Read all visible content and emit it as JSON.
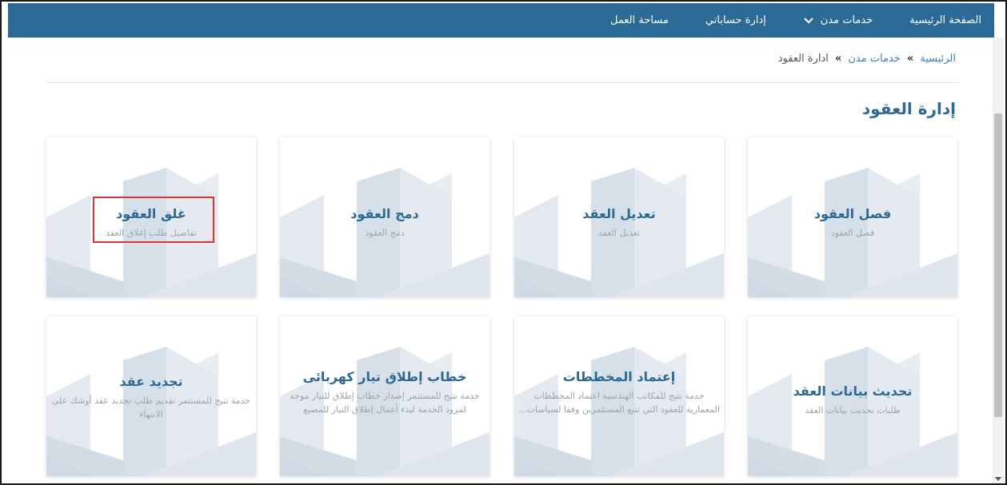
{
  "nav": {
    "items": [
      {
        "label": "الصفحة الرئيسية",
        "dropdown": false
      },
      {
        "label": "خدمات مدن",
        "dropdown": true
      },
      {
        "label": "إدارة حساباتي",
        "dropdown": false
      },
      {
        "label": "مساحة العمل",
        "dropdown": false
      }
    ]
  },
  "breadcrumb": {
    "home": "الرئيسية",
    "sep": "»",
    "services": "خدمات مدن",
    "current": "ادارة العقود"
  },
  "page": {
    "title": "إدارة العقود"
  },
  "cards": [
    {
      "title": "فصل العقود",
      "desc": "فصل العقود"
    },
    {
      "title": "تعديل العقد",
      "desc": "تعديل العقد"
    },
    {
      "title": "دمج العقود",
      "desc": "دمج العقود"
    },
    {
      "title": "غلق العقود",
      "desc": "تفاصيل طلب إغلاق العقد"
    },
    {
      "title": "تحديث بيانات العقد",
      "desc": "طلبات تحديث بيانات العقد"
    },
    {
      "title": "إعتماد المخططات",
      "desc": "خدمة تتيح للمكاتب الهندسية اعتماد المخططات المعمارية للعقود التي تتبع المستثمرين وفقا لسياسات..."
    },
    {
      "title": "خطاب إطلاق تيار كهربائى",
      "desc": "خدمة تتيح للمستثمر إصدار خطاب إطلاق للتيار موجه لمزود الخدمة لبدء أعمال إطلاق التيار للمصنع"
    },
    {
      "title": "تجديد عقد",
      "desc": "خدمة تتيح للمستثمر تقديم طلب تجديد عقد أوشك على الانتهاء"
    }
  ],
  "colors": {
    "navbar": "#2b6a96",
    "accent": "#2b6a96",
    "highlight": "#e0322f"
  }
}
